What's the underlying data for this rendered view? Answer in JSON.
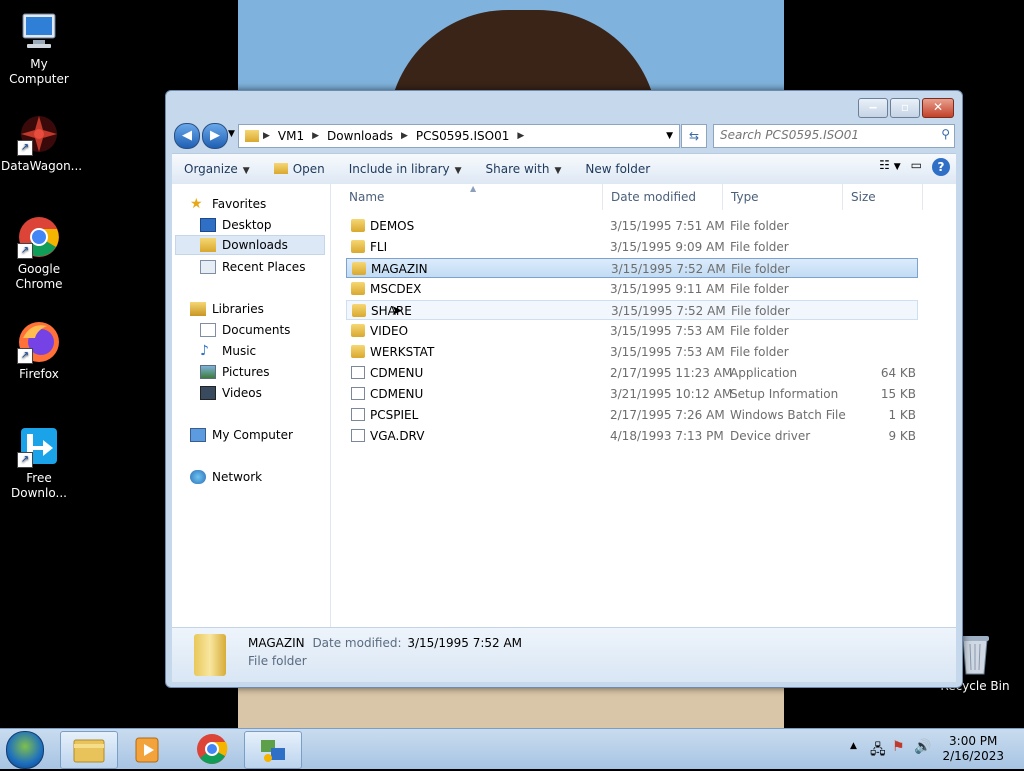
{
  "desktop": {
    "icons": [
      {
        "label": "My Computer"
      },
      {
        "label": "DataWagon..."
      },
      {
        "label": "Google Chrome"
      },
      {
        "label": "Firefox"
      },
      {
        "label": "Free Downlo..."
      },
      {
        "label": "Recycle Bin"
      }
    ]
  },
  "window": {
    "address": {
      "segments": [
        "VM1",
        "Downloads",
        "PCS0595.ISO01"
      ]
    },
    "search": {
      "placeholder": "Search PCS0595.ISO01"
    },
    "toolbar": {
      "organize": "Organize",
      "open": "Open",
      "include": "Include in library",
      "share": "Share with",
      "newfolder": "New folder"
    },
    "nav": {
      "favorites": "Favorites",
      "desktop": "Desktop",
      "downloads": "Downloads",
      "recent": "Recent Places",
      "libraries": "Libraries",
      "documents": "Documents",
      "music": "Music",
      "pictures": "Pictures",
      "videos": "Videos",
      "mycomputer": "My Computer",
      "network": "Network"
    },
    "columns": {
      "name": "Name",
      "date": "Date modified",
      "type": "Type",
      "size": "Size"
    },
    "files": [
      {
        "name": "DEMOS",
        "date": "3/15/1995 7:51 AM",
        "type": "File folder",
        "size": ""
      },
      {
        "name": "FLI",
        "date": "3/15/1995 9:09 AM",
        "type": "File folder",
        "size": ""
      },
      {
        "name": "MAGAZIN",
        "date": "3/15/1995 7:52 AM",
        "type": "File folder",
        "size": ""
      },
      {
        "name": "MSCDEX",
        "date": "3/15/1995 9:11 AM",
        "type": "File folder",
        "size": ""
      },
      {
        "name": "SHARE",
        "date": "3/15/1995 7:52 AM",
        "type": "File folder",
        "size": ""
      },
      {
        "name": "VIDEO",
        "date": "3/15/1995 7:53 AM",
        "type": "File folder",
        "size": ""
      },
      {
        "name": "WERKSTAT",
        "date": "3/15/1995 7:53 AM",
        "type": "File folder",
        "size": ""
      },
      {
        "name": "CDMENU",
        "date": "2/17/1995 11:23 AM",
        "type": "Application",
        "size": "64 KB"
      },
      {
        "name": "CDMENU",
        "date": "3/21/1995 10:12 AM",
        "type": "Setup Information",
        "size": "15 KB"
      },
      {
        "name": "PCSPIEL",
        "date": "2/17/1995 7:26 AM",
        "type": "Windows Batch File",
        "size": "1 KB"
      },
      {
        "name": "VGA.DRV",
        "date": "4/18/1993 7:13 PM",
        "type": "Device driver",
        "size": "9 KB"
      }
    ],
    "details": {
      "name": "MAGAZIN",
      "date_label": "Date modified:",
      "date_value": "3/15/1995 7:52 AM",
      "type": "File folder"
    }
  },
  "taskbar": {
    "time": "3:00 PM",
    "date": "2/16/2023"
  },
  "colors": {
    "selection": "#c2dcf3",
    "window_frame": "#c6d8ec",
    "desktop": "#000000"
  }
}
